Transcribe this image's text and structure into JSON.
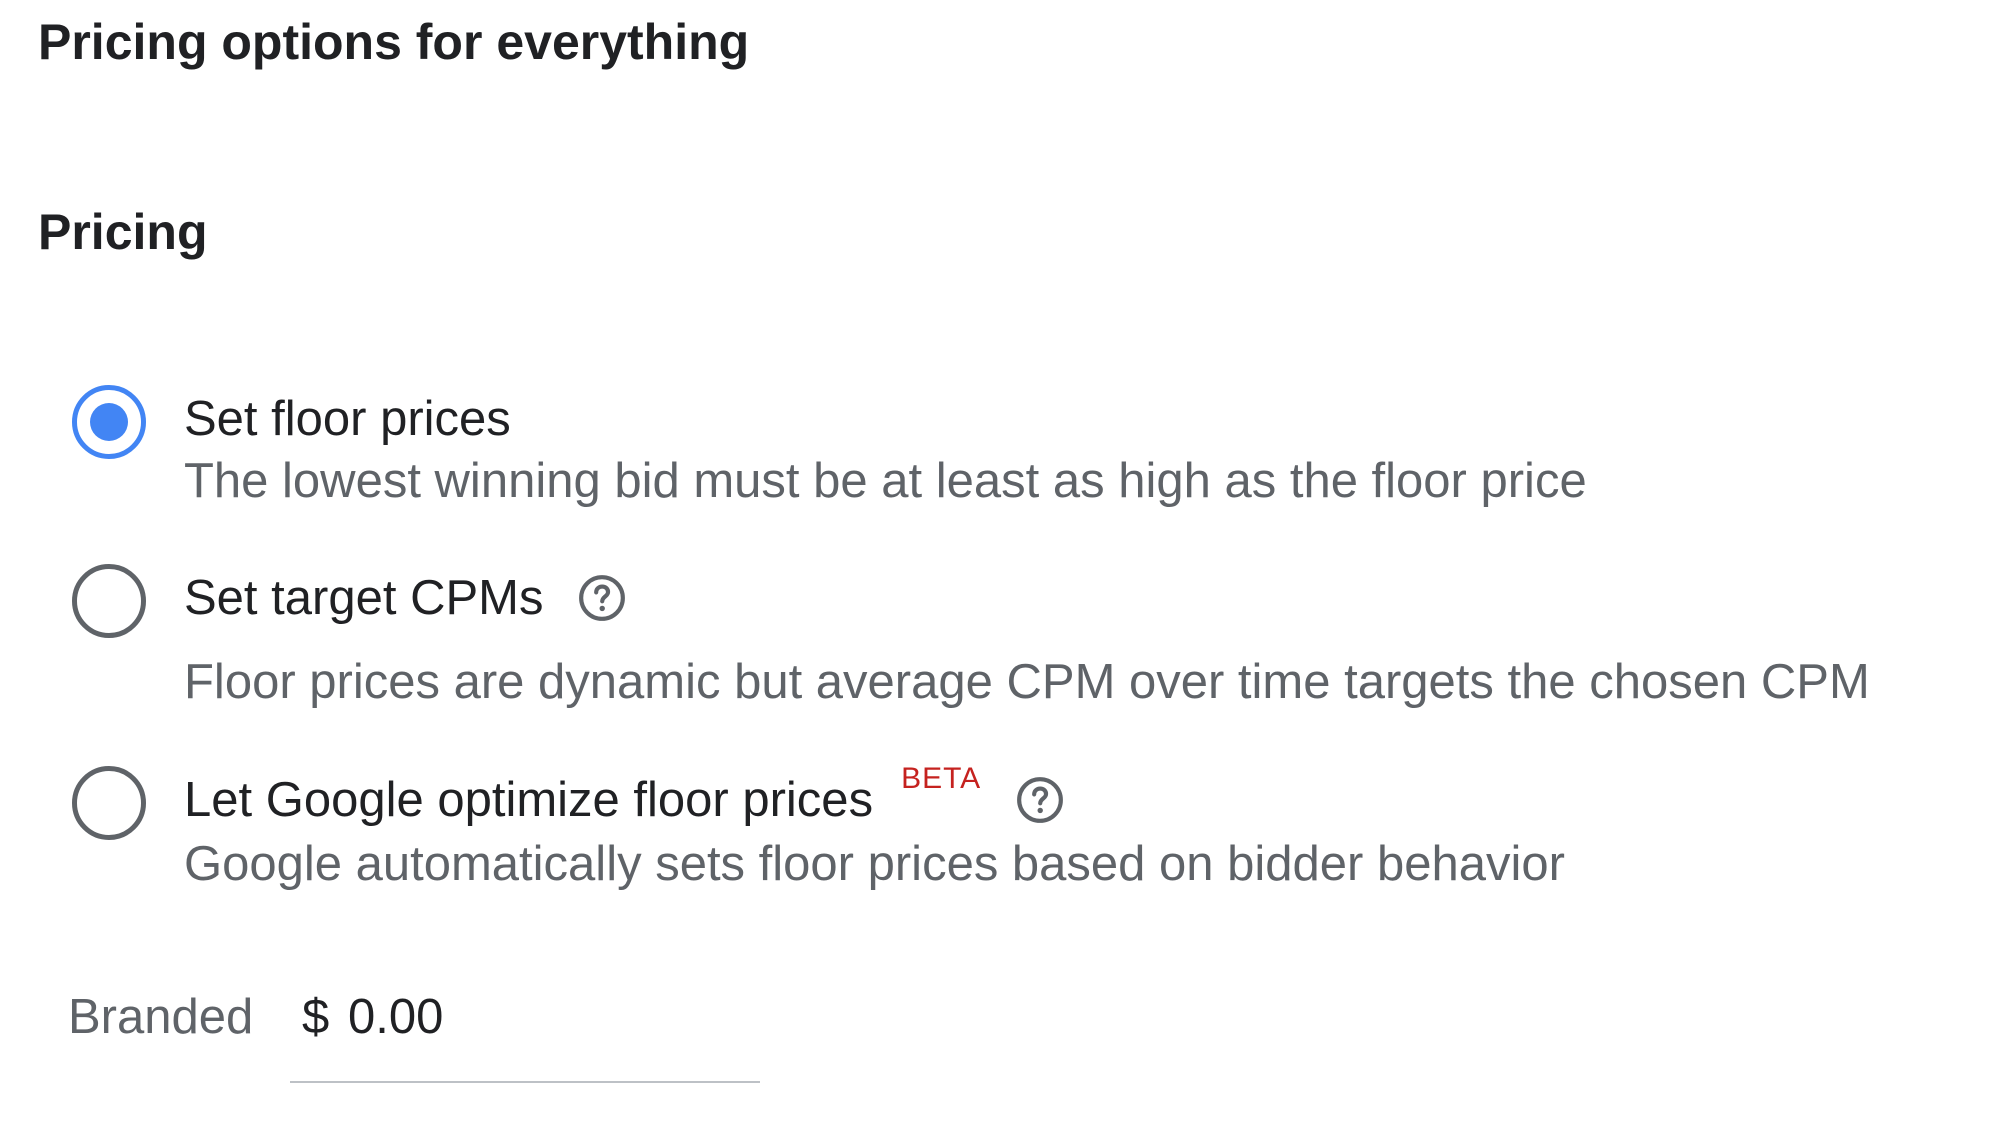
{
  "header": {
    "title": "Pricing options for everything"
  },
  "pricing": {
    "title": "Pricing",
    "options": [
      {
        "label": "Set floor prices",
        "description": "The lowest winning bid must be at least as high as the floor price",
        "selected": true,
        "icon": "radio-checked"
      },
      {
        "label": "Set target CPMs",
        "description": "Floor prices are dynamic but average CPM over time targets the chosen CPM",
        "selected": false,
        "icon": "help-circle-icon"
      },
      {
        "label": "Let Google optimize floor prices",
        "badge": "BETA",
        "description": "Google automatically sets floor prices based on bidder behavior",
        "selected": false,
        "icon": "help-circle-icon"
      }
    ]
  },
  "branded": {
    "label": "Branded",
    "currency": "$",
    "value": "0.00"
  },
  "colors": {
    "accent": "#4285f4",
    "badge": "#c5221f",
    "text": "#202124",
    "secondary_text": "#5f6368"
  }
}
